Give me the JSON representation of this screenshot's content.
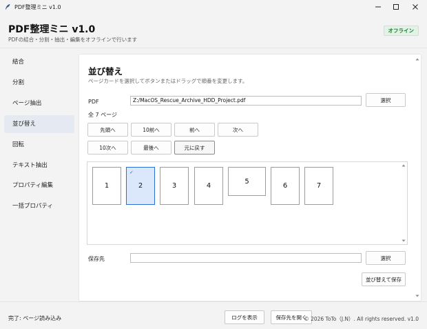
{
  "window": {
    "title": "PDF整理ミニ v1.0",
    "controls": [
      "minimize-icon",
      "maximize-icon",
      "close-icon"
    ]
  },
  "header": {
    "title": "PDF整理ミニ v1.0",
    "subtitle": "PDFの結合・分割・抽出・編集をオフラインで行います",
    "badge": "オフライン"
  },
  "sidebar": {
    "items": [
      {
        "label": "結合"
      },
      {
        "label": "分割"
      },
      {
        "label": "ページ抽出"
      },
      {
        "label": "並び替え",
        "active": true
      },
      {
        "label": "回転"
      },
      {
        "label": "テキスト抽出"
      },
      {
        "label": "プロパティ編集"
      },
      {
        "label": "一括プロパティ"
      }
    ]
  },
  "main": {
    "title": "並び替え",
    "description": "ページカードを選択してボタンまたはドラッグで順番を変更します。",
    "pdf_label": "PDF",
    "pdf_path": "Z:/MacOS_Rescue_Archive_HDD_Project.pdf",
    "select_button": "選択",
    "page_count": "全 7 ページ",
    "move_buttons": {
      "first": "先頭へ",
      "prev10": "10前へ",
      "prev": "前へ",
      "next": "次へ",
      "next10": "10次へ",
      "last": "最後へ",
      "reset": "元に戻す"
    },
    "pages": [
      "1",
      "2",
      "3",
      "4",
      "5",
      "6",
      "7"
    ],
    "selected_page": "2",
    "save_label": "保存先",
    "save_path": "",
    "save_select_button": "選択",
    "save_button": "並び替えて保存"
  },
  "status": {
    "text": "完了: ページ読み込み",
    "log_button": "ログを表示",
    "open_folder_button": "保存先を開く",
    "copyright": "© 2026 ToTo（J.N）. All rights reserved.  v1.0"
  },
  "colors": {
    "accent": "#2a6fd6",
    "selected_card_bg": "#dbe8fb",
    "badge_bg": "#e2f3e6",
    "badge_text": "#1e7a34",
    "active_nav_bg": "#e5eaf2"
  }
}
